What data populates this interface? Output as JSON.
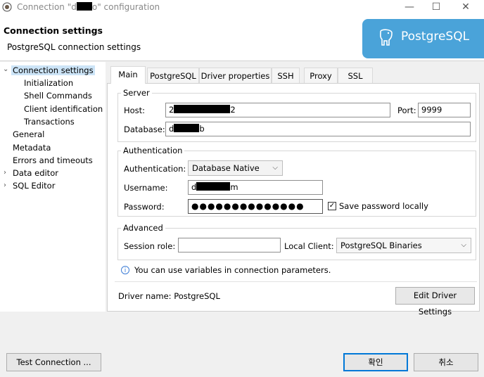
{
  "window": {
    "title_prefix": "Connection \"d",
    "title_suffix": "o\" configuration",
    "minimize": "—",
    "maximize": "☐",
    "close": "✕"
  },
  "header": {
    "title": "Connection settings",
    "subtitle": "PostgreSQL connection settings",
    "brand": "PostgreSQL"
  },
  "tree": {
    "items": [
      {
        "label": "Connection settings"
      },
      {
        "label": "Initialization"
      },
      {
        "label": "Shell Commands"
      },
      {
        "label": "Client identification"
      },
      {
        "label": "Transactions"
      },
      {
        "label": "General"
      },
      {
        "label": "Metadata"
      },
      {
        "label": "Errors and timeouts"
      },
      {
        "label": "Data editor"
      },
      {
        "label": "SQL Editor"
      }
    ]
  },
  "tabs": [
    "Main",
    "PostgreSQL",
    "Driver properties",
    "SSH",
    "Proxy",
    "SSL"
  ],
  "server": {
    "group_label": "Server",
    "host_label": "Host:",
    "host_value_start": "2",
    "host_value_end": "2",
    "port_label": "Port:",
    "port_value": "9999",
    "database_label": "Database:",
    "database_value_start": "d",
    "database_value_end": "b"
  },
  "auth": {
    "group_label": "Authentication",
    "auth_label": "Authentication:",
    "auth_value": "Database Native",
    "username_label": "Username:",
    "username_value_start": "d",
    "username_value_end": "m",
    "password_label": "Password:",
    "password_value": "●●●●●●●●●●●●●●",
    "save_password_label": "Save password locally",
    "save_password_checked": true
  },
  "advanced": {
    "group_label": "Advanced",
    "session_role_label": "Session role:",
    "session_role_value": "",
    "local_client_label": "Local Client:",
    "local_client_value": "PostgreSQL Binaries"
  },
  "info_text": "You can use variables in connection parameters.",
  "driver": {
    "label": "Driver name:",
    "value": "PostgreSQL",
    "edit_button": "Edit Driver Settings"
  },
  "footer": {
    "test_button": "Test Connection ...",
    "ok_button": "확인",
    "cancel_button": "취소"
  },
  "icons": {
    "info": "info-icon",
    "checkmark": "✓",
    "chevron_down": "⌵",
    "tree_expanded": "⌄",
    "tree_collapsed": "›"
  },
  "colors": {
    "accent": "#0078d7",
    "brand": "#4aa3d9",
    "selection": "#cce4f7"
  }
}
